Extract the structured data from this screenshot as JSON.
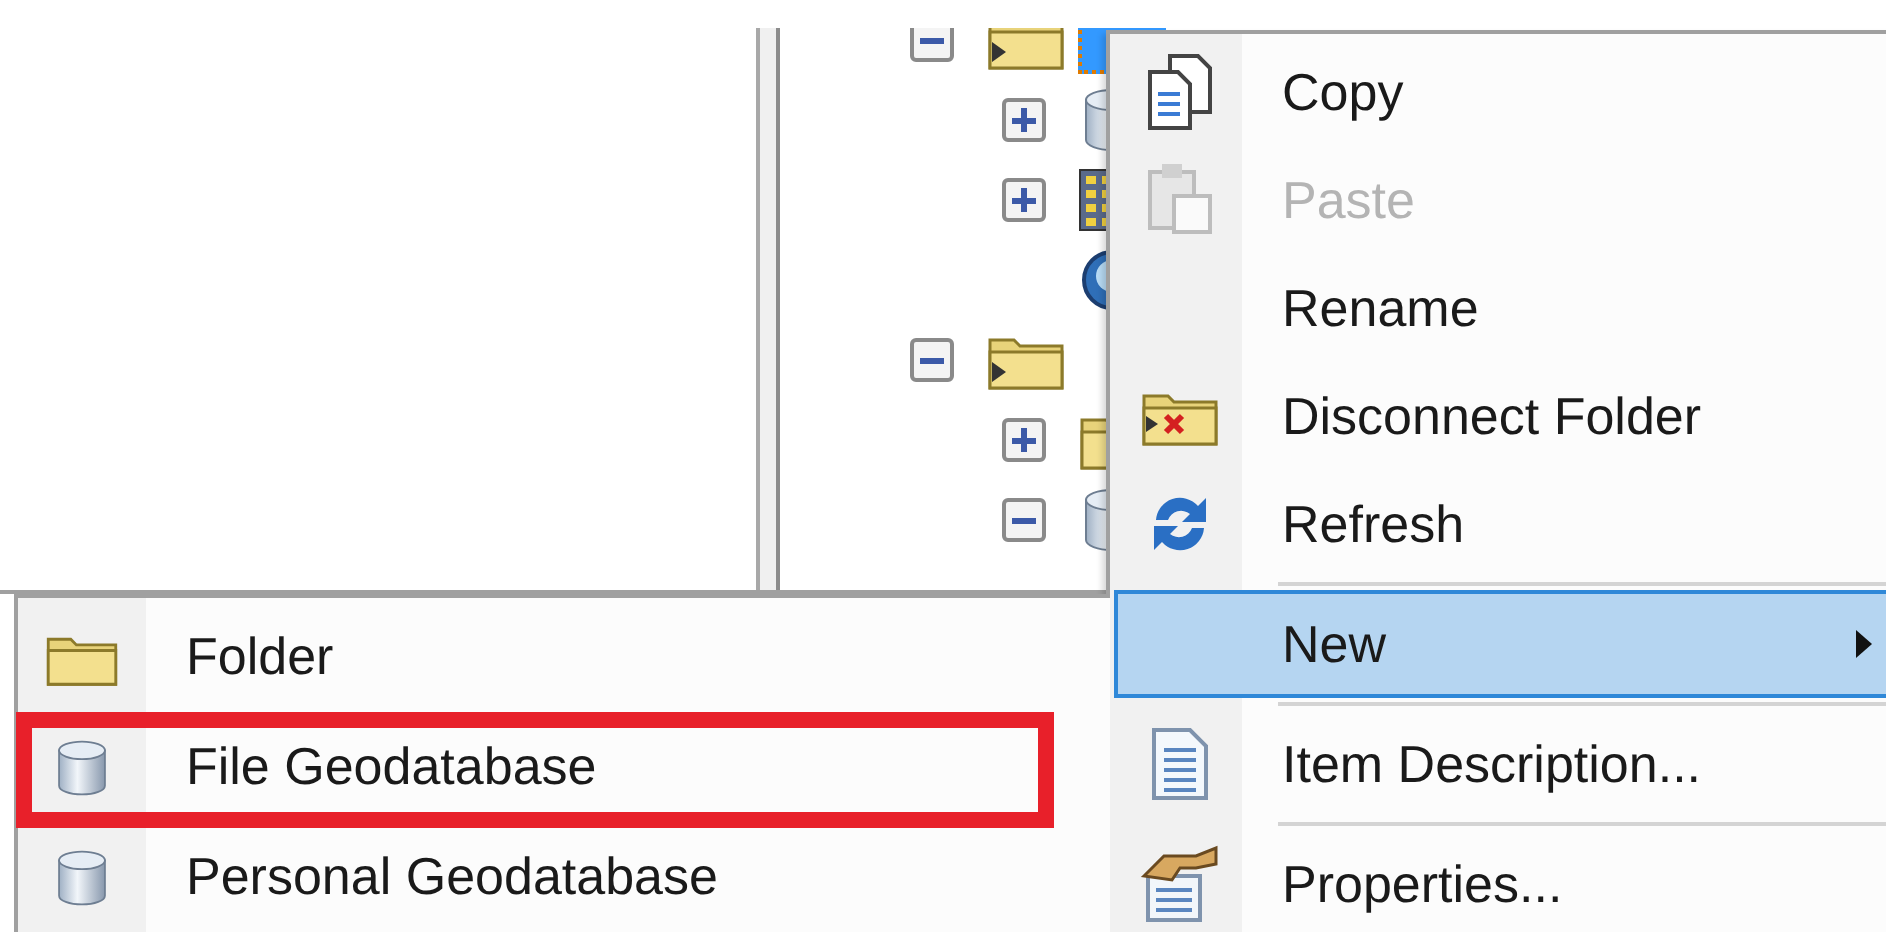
{
  "tree": [
    {
      "kind": "folder-connection",
      "expanded": true,
      "selected": true,
      "children": [
        {
          "kind": "database",
          "expanded": false,
          "selected": false
        },
        {
          "kind": "raster",
          "expanded": false,
          "selected": false
        },
        {
          "kind": "globe",
          "selected": false
        }
      ]
    },
    {
      "kind": "folder-connection",
      "expanded": true,
      "selected": false,
      "children": [
        {
          "kind": "folder",
          "expanded": false,
          "selected": false
        },
        {
          "kind": "database",
          "expanded": true,
          "selected": false
        }
      ]
    }
  ],
  "context_menu": {
    "items": [
      {
        "kind": "copy",
        "label": "Copy",
        "disabled": false,
        "selected": false,
        "submenu": false
      },
      {
        "kind": "paste",
        "label": "Paste",
        "disabled": true,
        "selected": false,
        "submenu": false
      },
      {
        "kind": "plain",
        "label": "Rename",
        "disabled": false,
        "selected": false,
        "submenu": false
      },
      {
        "kind": "disconnect",
        "label": "Disconnect Folder",
        "disabled": false,
        "selected": false,
        "submenu": false
      },
      {
        "kind": "refresh",
        "label": "Refresh",
        "disabled": false,
        "selected": false,
        "submenu": false
      },
      {
        "kind": "separator"
      },
      {
        "kind": "plain",
        "label": "New",
        "disabled": false,
        "selected": true,
        "submenu": true
      },
      {
        "kind": "separator"
      },
      {
        "kind": "description",
        "label": "Item Description...",
        "disabled": false,
        "selected": false,
        "submenu": false
      },
      {
        "kind": "separator"
      },
      {
        "kind": "properties",
        "label": "Properties...",
        "disabled": false,
        "selected": false,
        "submenu": false
      }
    ]
  },
  "submenu": {
    "items": [
      {
        "kind": "folder",
        "label": "Folder",
        "highlighted": false
      },
      {
        "kind": "database",
        "label": "File Geodatabase",
        "highlighted": true
      },
      {
        "kind": "database",
        "label": "Personal Geodatabase",
        "highlighted": false
      }
    ]
  }
}
